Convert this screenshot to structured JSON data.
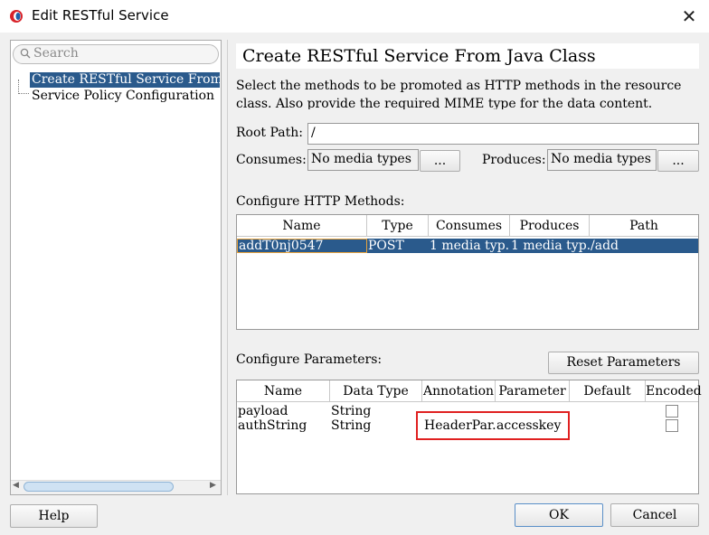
{
  "window": {
    "title": "Edit RESTful Service"
  },
  "nav": {
    "search_placeholder": "Search",
    "items": [
      {
        "label": "Create RESTful Service From Jav"
      },
      {
        "label": "Service Policy Configuration"
      }
    ]
  },
  "main": {
    "header": "Create RESTful Service From Java Class",
    "description": "Select the methods to be promoted as HTTP methods in the resource class. Also provide the required MIME type for the data content.",
    "root_path_label": "Root Path:",
    "root_path_value": "/",
    "consumes_label": "Consumes:",
    "consumes_value": "No media types",
    "produces_label": "Produces:",
    "produces_value": "No media types",
    "ellipsis": "...",
    "methods_label": "Configure HTTP Methods:",
    "methods_table": {
      "columns": [
        "Name",
        "Type",
        "Consumes",
        "Produces",
        "Path"
      ],
      "rows": [
        [
          "addT0nj0547",
          "POST",
          "1 media typ...",
          "1 media typ...",
          "/add"
        ]
      ]
    },
    "params_label": "Configure Parameters:",
    "reset_button": "Reset Parameters",
    "params_table": {
      "columns": [
        "Name",
        "Data Type",
        "Annotation",
        "Parameter",
        "Default",
        "Encoded"
      ],
      "rows": [
        [
          "payload",
          "String",
          "",
          "",
          "",
          ""
        ],
        [
          "authString",
          "String",
          "HeaderPar...",
          "accesskey",
          "",
          ""
        ]
      ]
    }
  },
  "footer": {
    "help": "Help",
    "ok": "OK",
    "cancel": "Cancel"
  },
  "colors": {
    "selection": "#2a5a8c",
    "highlight_border": "#e02020",
    "accent_icon": "#d8232a"
  }
}
